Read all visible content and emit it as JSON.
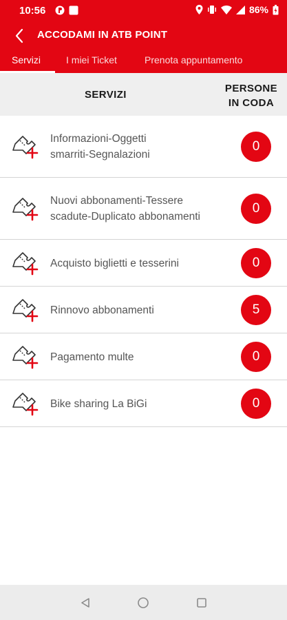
{
  "status_bar": {
    "time": "10:56",
    "battery": "86%"
  },
  "toolbar": {
    "title": "ACCODAMI IN ATB POINT"
  },
  "tabs": [
    {
      "label": "Servizi",
      "active": true
    },
    {
      "label": "I miei Ticket",
      "active": false
    },
    {
      "label": "Prenota appuntamento",
      "active": false
    }
  ],
  "table_header": {
    "services": "SERVIZI",
    "queue_line1": "PERSONE",
    "queue_line2": "IN CODA"
  },
  "services": [
    {
      "line1": "Informazioni-Oggetti",
      "line2": "smarriti-Segnalazioni",
      "count": "0"
    },
    {
      "line1": "Nuovi abbonamenti-Tessere",
      "line2": "scadute-Duplicato abbonamenti",
      "count": "0"
    },
    {
      "line1": "Acquisto biglietti e tesserini",
      "line2": "",
      "count": "0"
    },
    {
      "line1": "Rinnovo abbonamenti",
      "line2": "",
      "count": "5"
    },
    {
      "line1": "Pagamento multe",
      "line2": "",
      "count": "0"
    },
    {
      "line1": "Bike sharing La BiGi",
      "line2": "",
      "count": "0"
    }
  ],
  "icons": {
    "back": "arrow-left-icon",
    "service": "ticket-add-icon",
    "nav_back": "triangle-back-icon",
    "nav_home": "circle-home-icon",
    "nav_recent": "square-recent-icon"
  },
  "colors": {
    "brand_red": "#e30613",
    "header_bg": "#efefef",
    "nav_bg": "#ececec"
  }
}
